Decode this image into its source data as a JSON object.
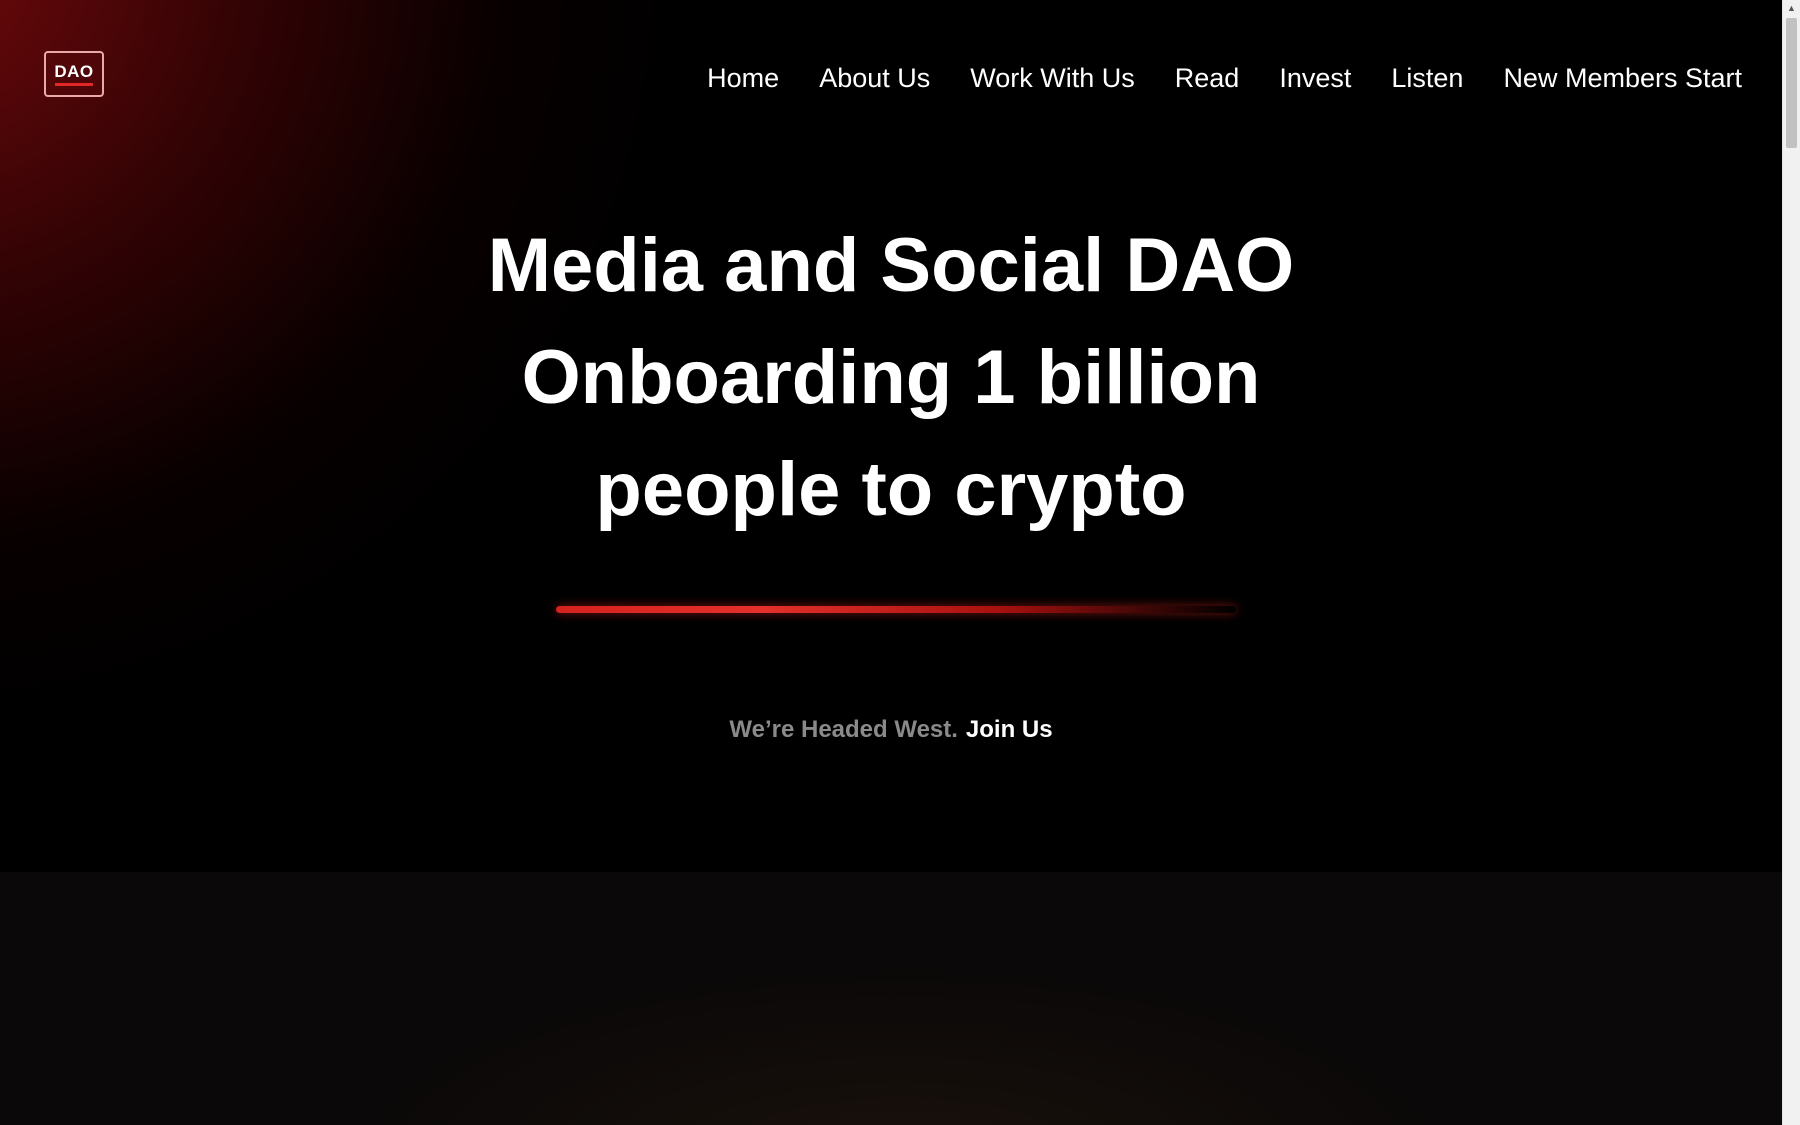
{
  "logo": {
    "text": "DAO"
  },
  "nav": {
    "items": [
      {
        "label": "Home"
      },
      {
        "label": "About Us"
      },
      {
        "label": "Work With Us"
      },
      {
        "label": "Read"
      },
      {
        "label": "Invest"
      },
      {
        "label": "Listen"
      },
      {
        "label": "New Members Start"
      }
    ]
  },
  "hero": {
    "headline_lines": [
      "Media and Social DAO",
      "Onboarding 1 billion",
      "people to crypto"
    ],
    "tagline": "We’re Headed West.",
    "cta_label": "Join Us"
  },
  "colors": {
    "accent_red": "#e32626",
    "background": "#000000",
    "muted_text": "#8a8a8a"
  }
}
